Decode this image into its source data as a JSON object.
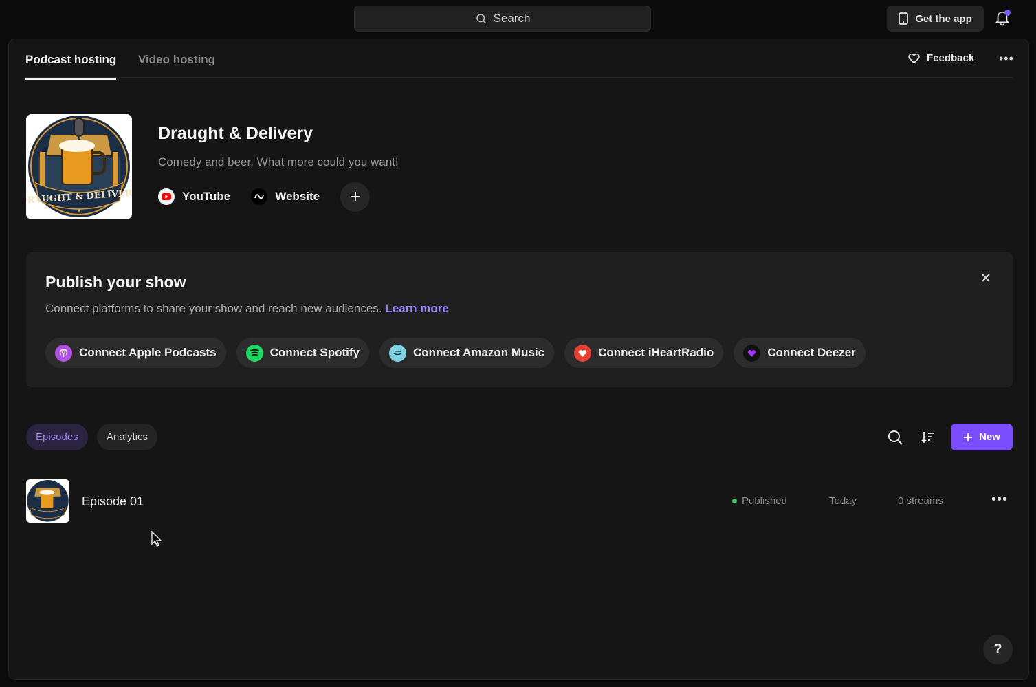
{
  "topbar": {
    "search_label": "Search",
    "get_app_label": "Get the app"
  },
  "tabs": [
    {
      "label": "Podcast hosting",
      "active": true
    },
    {
      "label": "Video hosting",
      "active": false
    }
  ],
  "feedback_label": "Feedback",
  "show": {
    "title": "Draught & Delivery",
    "description": "Comedy and beer. What more could you want!",
    "cover_text": "DRAUGHT & DELIVERY",
    "links": [
      {
        "label": "YouTube",
        "icon": "youtube-icon"
      },
      {
        "label": "Website",
        "icon": "website-icon"
      }
    ]
  },
  "publish": {
    "title": "Publish your show",
    "subtitle": "Connect platforms to share your show and reach new audiences.",
    "learn_more": "Learn more",
    "platforms": [
      {
        "label": "Connect Apple Podcasts",
        "icon": "apple-podcasts-icon",
        "color": "#b150e2"
      },
      {
        "label": "Connect Spotify",
        "icon": "spotify-icon",
        "color": "#1ed760"
      },
      {
        "label": "Connect Amazon Music",
        "icon": "amazon-music-icon",
        "color": "#7fd4e3"
      },
      {
        "label": "Connect iHeartRadio",
        "icon": "iheartradio-icon",
        "color": "#e8412f"
      },
      {
        "label": "Connect Deezer",
        "icon": "deezer-icon",
        "color": "#a238ff"
      }
    ]
  },
  "episodes_section": {
    "tabs": [
      {
        "label": "Episodes",
        "active": true
      },
      {
        "label": "Analytics",
        "active": false
      }
    ],
    "new_label": "New",
    "episodes": [
      {
        "title": "Episode 01",
        "status": "Published",
        "date": "Today",
        "streams": "0 streams"
      }
    ]
  },
  "help_label": "?",
  "colors": {
    "accent": "#7c4dff",
    "published_dot": "#4cc46a",
    "notification_dot": "#7c5cff"
  }
}
